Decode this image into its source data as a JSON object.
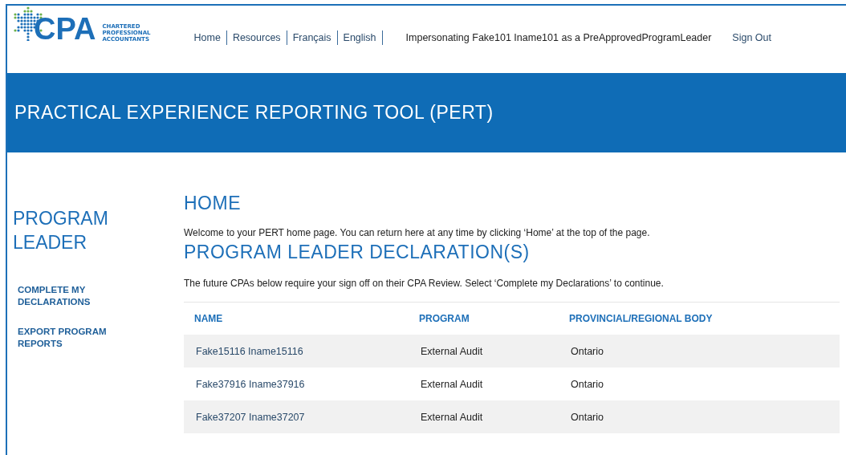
{
  "logo": {
    "mark": "CPA",
    "lines": [
      "CHARTERED",
      "PROFESSIONAL",
      "ACCOUNTANTS"
    ]
  },
  "nav": [
    "Home",
    "Resources",
    "Français",
    "English"
  ],
  "impersonation": "Impersonating Fake101 Iname101 as a PreApprovedProgramLeader",
  "sign_out": "Sign Out",
  "banner": {
    "title": "PRACTICAL EXPERIENCE REPORTING TOOL (PERT)"
  },
  "sidebar": {
    "title": "PROGRAM LEADER",
    "items": [
      "COMPLETE MY DECLARATIONS",
      "EXPORT PROGRAM REPORTS"
    ]
  },
  "home": {
    "heading": "HOME",
    "intro": "Welcome to your PERT home page. You can return here at any time by clicking ‘Home’ at the top of the page."
  },
  "declarations": {
    "heading": "PROGRAM LEADER DECLARATION(S)",
    "intro": "The future CPAs below require your sign off on their CPA Review. Select ‘Complete my Declarations’ to continue."
  },
  "table": {
    "columns": [
      "NAME",
      "PROGRAM",
      "PROVINCIAL/REGIONAL BODY"
    ],
    "rows": [
      {
        "name": "Fake15116 Iname15116",
        "program": "External Audit",
        "body": "Ontario"
      },
      {
        "name": "Fake37916 Iname37916",
        "program": "External Audit",
        "body": "Ontario"
      },
      {
        "name": "Fake37207 Iname37207",
        "program": "External Audit",
        "body": "Ontario"
      }
    ]
  }
}
